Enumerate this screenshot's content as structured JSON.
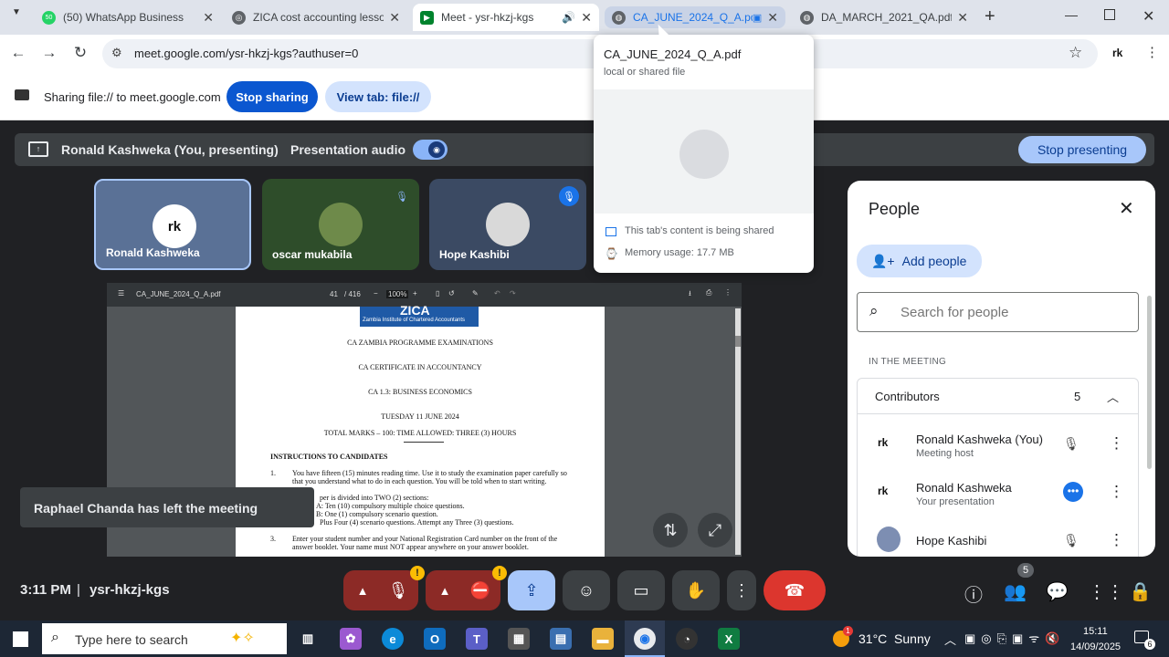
{
  "browser": {
    "tabs": [
      {
        "title": "(50) WhatsApp Business",
        "icon": "whatsapp-icon"
      },
      {
        "title": "ZICA cost accounting lesson",
        "icon": "chrome-globe-icon"
      },
      {
        "title": "Meet - ysr-hkzj-kgs",
        "icon": "google-meet-icon"
      },
      {
        "title": "CA_JUNE_2024_Q_A.pdf",
        "icon": "globe-icon"
      },
      {
        "title": "DA_MARCH_2021_QA.pdf",
        "icon": "globe-icon"
      }
    ],
    "favicon_badge": "50",
    "new_tab": "+",
    "url": "meet.google.com/ysr-hkzj-kgs?authuser=0",
    "profile_initials": "rk"
  },
  "share_bar": {
    "text": "Sharing file:// to meet.google.com",
    "stop_sharing": "Stop sharing",
    "view_tab": "View tab: file://"
  },
  "tab_popup": {
    "title": "CA_JUNE_2024_Q_A.pdf",
    "subtitle": "local or shared file",
    "sharing_status": "This tab's content is being shared",
    "memory": "Memory usage: 17.7 MB"
  },
  "presenting_bar": {
    "presenter": "Ronald Kashweka (You, presenting)",
    "audio_label": "Presentation audio",
    "stop_presenting": "Stop presenting"
  },
  "tiles": [
    {
      "name": "Ronald Kashweka",
      "avatar": "rk"
    },
    {
      "name": "oscar mukabila"
    },
    {
      "name": "Hope Kashibi"
    }
  ],
  "pdf_viewer": {
    "filename": "CA_JUNE_2024_Q_A.pdf",
    "page_current": "41",
    "page_total": "/ 416",
    "zoom": "100%",
    "minus": "−",
    "plus": "+",
    "header_logo_text": "ZICA",
    "header_logo_sub": "Zambia Institute of Chartered Accountants",
    "lines": [
      "CA ZAMBIA PROGRAMME EXAMINATIONS",
      "CA CERTIFICATE IN ACCOUNTANCY",
      "CA 1.3: BUSINESS ECONOMICS",
      "TUESDAY 11 JUNE 2024",
      "TOTAL MARKS – 100: TIME ALLOWED: THREE (3) HOURS"
    ],
    "instructions_heading": "INSTRUCTIONS TO CANDIDATES",
    "items": [
      {
        "num": "1.",
        "text": "You have fifteen (15) minutes reading time. Use it to study the examination paper carefully so that you understand what to do in each question. You will be told when to start writing."
      },
      {
        "num": "",
        "text": "per is divided into TWO (2) sections:"
      },
      {
        "num": "",
        "text": "A: Ten (10) compulsory multiple choice questions."
      },
      {
        "num": "",
        "text": "B: One (1) compulsory scenario question."
      },
      {
        "num": "",
        "text": "Plus Four (4) scenario questions. Attempt any Three (3) questions."
      },
      {
        "num": "3.",
        "text": "Enter your student number and your National Registration Card number on the front of the answer booklet. Your name must NOT appear anywhere on your answer booklet."
      }
    ]
  },
  "toast": "Raphael Chanda has left the meeting",
  "people_panel": {
    "title": "People",
    "add_people": "Add people",
    "search_placeholder": "Search for people",
    "section": "IN THE MEETING",
    "group": "Contributors",
    "count": "5",
    "people": [
      {
        "name": "Ronald Kashweka (You)",
        "role": "Meeting host"
      },
      {
        "name": "Ronald Kashweka",
        "role": "Your presentation"
      },
      {
        "name": "Hope Kashibi",
        "role": ""
      }
    ]
  },
  "bottom_bar": {
    "time": "3:11 PM",
    "separator": "|",
    "meeting_code": "ysr-hkzj-kgs",
    "participants_count": "5",
    "warning": "!"
  },
  "taskbar": {
    "search_placeholder": "Type here to search",
    "weather": "31°C  Sunny",
    "weather_badge": "1",
    "clock_time": "15:11",
    "clock_date": "14/09/2025",
    "notification_count": "6"
  },
  "colors": {
    "accent_blue": "#1a73e8",
    "pill_blue": "#0b57d0",
    "light_blue": "#d3e3fd",
    "end_call_red": "#dc362e",
    "meet_bg": "#202124"
  }
}
